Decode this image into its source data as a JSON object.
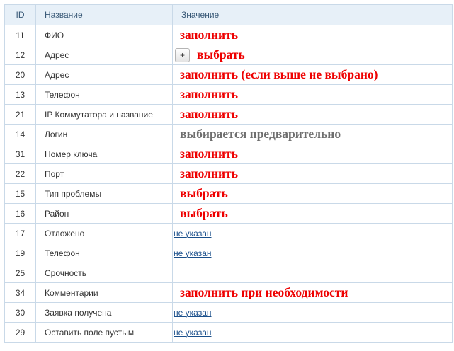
{
  "table": {
    "headers": {
      "id": "ID",
      "name": "Название",
      "value": "Значение"
    },
    "rows": [
      {
        "id": "11",
        "name": "ФИО",
        "annotation": "заполнить"
      },
      {
        "id": "12",
        "name": "Адрес",
        "button": "+",
        "annotation": "выбрать"
      },
      {
        "id": "20",
        "name": "Адрес",
        "annotation": "заполнить (если выше не выбрано)"
      },
      {
        "id": "13",
        "name": "Телефон",
        "annotation": "заполнить"
      },
      {
        "id": "21",
        "name": "IP Коммутатора и название",
        "annotation": "заполнить"
      },
      {
        "id": "14",
        "name": "Логин",
        "annotation": "выбирается предварительно"
      },
      {
        "id": "31",
        "name": "Номер ключа",
        "annotation": "заполнить"
      },
      {
        "id": "22",
        "name": "Порт",
        "annotation": "заполнить"
      },
      {
        "id": "15",
        "name": "Тип проблемы",
        "annotation": "выбрать"
      },
      {
        "id": "16",
        "name": "Район",
        "annotation": "выбрать"
      },
      {
        "id": "17",
        "name": "Отложено",
        "link": "не указан"
      },
      {
        "id": "19",
        "name": "Телефон",
        "link": "не указан"
      },
      {
        "id": "25",
        "name": "Срочность"
      },
      {
        "id": "34",
        "name": "Комментарии",
        "annotation": "заполнить при необходимости"
      },
      {
        "id": "30",
        "name": "Заявка получена",
        "link": "не указан"
      },
      {
        "id": "29",
        "name": "Оставить поле пустым",
        "link": "не указан"
      }
    ]
  },
  "colors": {
    "annotation": "#ee0000",
    "annotation_muted": "#6e6e6e",
    "link": "#1a4f8b",
    "header_bg": "#e7f0f8",
    "border": "#c9d9e8"
  }
}
